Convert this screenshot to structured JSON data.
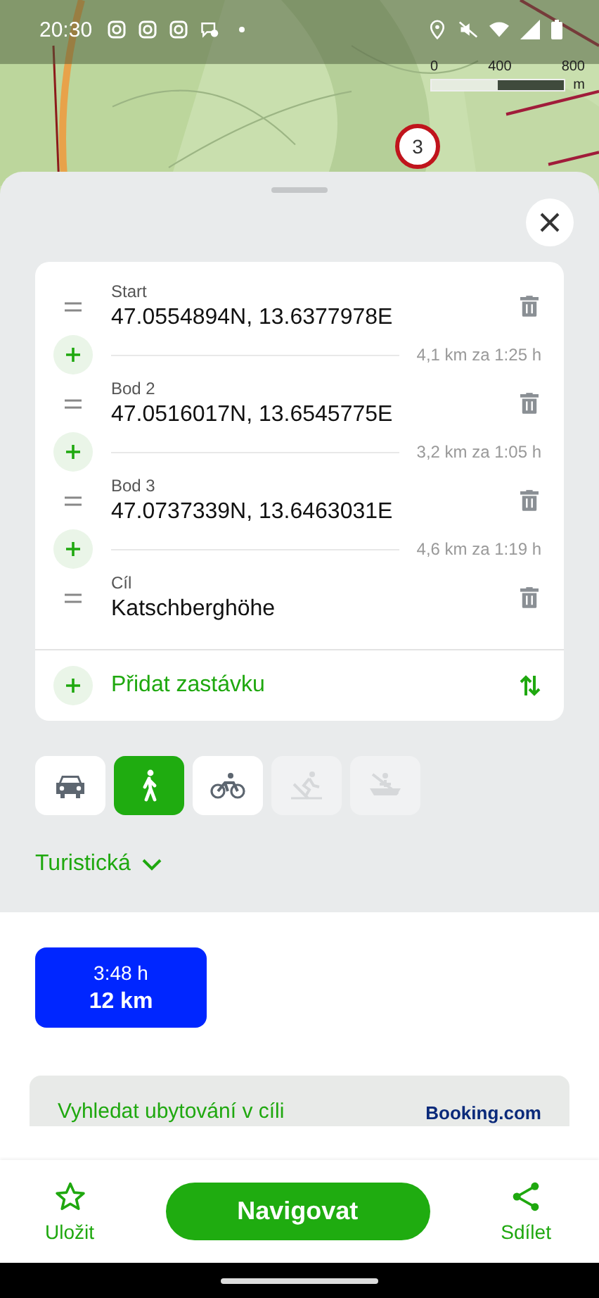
{
  "status_bar": {
    "time": "20:30"
  },
  "map": {
    "scale_labels": [
      "0",
      "400",
      "800"
    ],
    "scale_unit": "m",
    "marker": "3"
  },
  "waypoints": [
    {
      "label": "Start",
      "value": "47.0554894N, 13.6377978E",
      "leg": "4,1 km za 1:25 h"
    },
    {
      "label": "Bod 2",
      "value": "47.0516017N, 13.6545775E",
      "leg": "3,2 km za 1:05 h"
    },
    {
      "label": "Bod 3",
      "value": "47.0737339N, 13.6463031E",
      "leg": "4,6 km za 1:19 h"
    },
    {
      "label": "Cíl",
      "value": "Katschberghöhe"
    }
  ],
  "add_stop": "Přidat zastávku",
  "modes": [
    {
      "kind": "car",
      "selected": false,
      "disabled": false
    },
    {
      "kind": "walk",
      "selected": true,
      "disabled": false
    },
    {
      "kind": "bike",
      "selected": false,
      "disabled": false
    },
    {
      "kind": "ski",
      "selected": false,
      "disabled": true
    },
    {
      "kind": "boat",
      "selected": false,
      "disabled": true
    }
  ],
  "route_type": "Turistická",
  "routes": [
    {
      "time": "3:48 h",
      "distance": "12 km",
      "selected": true
    }
  ],
  "booking": {
    "text": "Vyhledat ubytování v cíli",
    "brand": "Booking.com"
  },
  "bottom_bar": {
    "save": "Uložit",
    "navigate": "Navigovat",
    "share": "Sdílet"
  }
}
